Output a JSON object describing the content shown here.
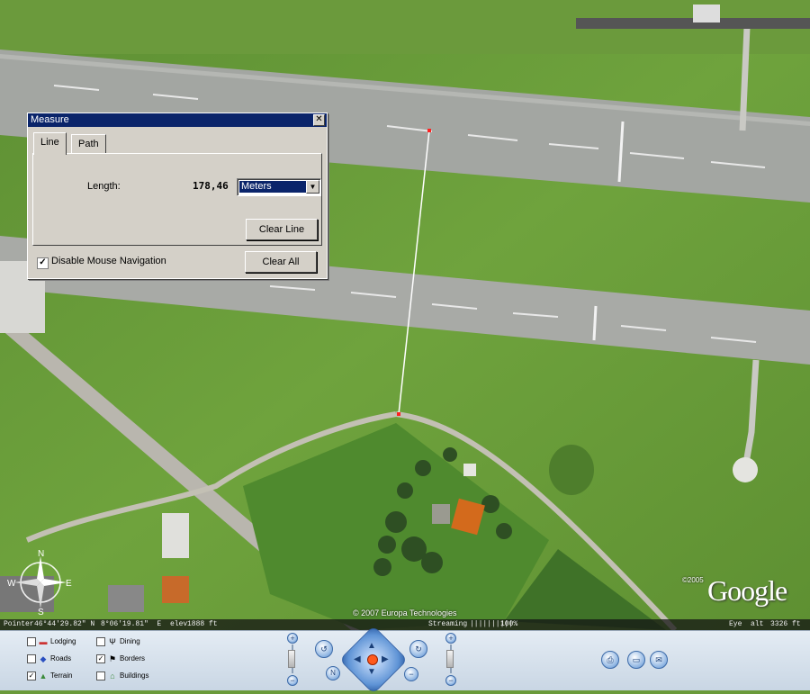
{
  "map": {
    "copyright_left": "© 2007 Europa Technologies",
    "copyright_year": "©2005",
    "logo": "Google",
    "compass": {
      "n": "N",
      "s": "S",
      "e": "E",
      "w": "W"
    }
  },
  "statusbar": {
    "pointer_label": "Pointer",
    "latitude": "46°44'29.82\" N",
    "longitude": "8°06'19.81\"  E",
    "elev_label": "elev",
    "elev_value": "1888 ft",
    "streaming_label": "Streaming",
    "streaming_bar": "||||||||||",
    "streaming_pct": "100%",
    "eye_label": "Eye  alt",
    "eye_value": "3326 ft"
  },
  "measure": {
    "title": "Measure",
    "close": "✕",
    "tabs": [
      "Line",
      "Path"
    ],
    "length_label": "Length:",
    "length_value": "178,46",
    "unit": "Meters",
    "clear_line": "Clear Line",
    "disable_nav": "Disable Mouse Navigation",
    "disable_nav_checked": "✓",
    "clear_all": "Clear All"
  },
  "layers": [
    {
      "label": "Lodging",
      "checked": "",
      "icon": "bed-icon",
      "glyph": "▬"
    },
    {
      "label": "Dining",
      "checked": "",
      "icon": "fork-knife-icon",
      "glyph": "Ψ"
    },
    {
      "label": "Roads",
      "checked": "",
      "icon": "road-shield-icon",
      "glyph": "◆"
    },
    {
      "label": "Borders",
      "checked": "✓",
      "icon": "flag-icon",
      "glyph": "⚑"
    },
    {
      "label": "Terrain",
      "checked": "✓",
      "icon": "mountain-icon",
      "glyph": "▲"
    },
    {
      "label": "Buildings",
      "checked": "",
      "icon": "building-icon",
      "glyph": "⌂"
    }
  ],
  "nav": {
    "plus": "+",
    "minus": "−",
    "north": "N",
    "rotate_ccw": "↺",
    "rotate_cw": "↻",
    "up": "▲",
    "down": "▼",
    "left": "◀",
    "right": "▶"
  },
  "tools": {
    "print_icon": "⎙",
    "bus_icon": "▭",
    "mail_icon": "✉"
  }
}
